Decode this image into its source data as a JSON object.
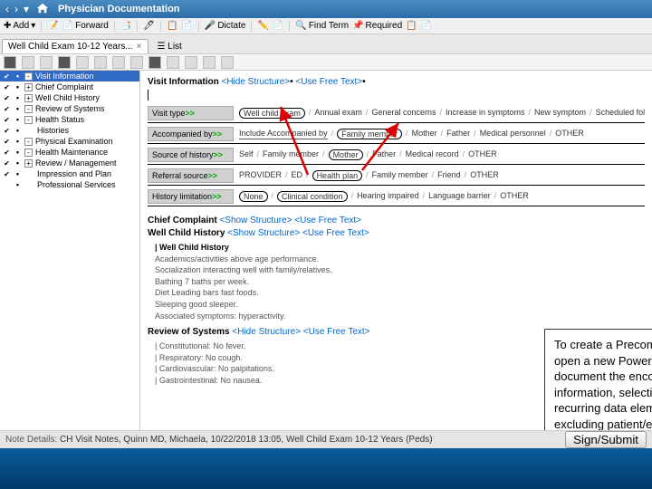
{
  "titlebar": {
    "back": "‹",
    "fwd": "›",
    "dropdown": "▾",
    "title": "Physician Documentation"
  },
  "toolbar1": {
    "add": "Add",
    "forward": "Forward",
    "dictate": "Dictate",
    "findterm": "Find Term",
    "required": "Required"
  },
  "tab": {
    "label": "Well Child Exam 10-12 Years...",
    "close": "×",
    "list": "List"
  },
  "sidebar": [
    {
      "c": true,
      "pm": "-",
      "label": "Visit Information",
      "sel": true
    },
    {
      "c": true,
      "pm": "+",
      "label": "Chief Complaint"
    },
    {
      "c": true,
      "pm": "+",
      "label": "Well Child History"
    },
    {
      "c": true,
      "pm": "-",
      "label": "Review of Systems"
    },
    {
      "c": true,
      "pm": "-",
      "label": "Health Status"
    },
    {
      "c": true,
      "pm": "",
      "label": "Histories"
    },
    {
      "c": true,
      "pm": "-",
      "label": "Physical Examination"
    },
    {
      "c": true,
      "pm": "-",
      "label": "Health Maintenance"
    },
    {
      "c": true,
      "pm": "+",
      "label": "Review / Management"
    },
    {
      "c": true,
      "pm": "",
      "label": "Impression and Plan"
    },
    {
      "c": false,
      "pm": "",
      "label": "Professional Services"
    }
  ],
  "sections": {
    "visit_info": {
      "title": "Visit Information",
      "hide": "<Hide Structure>",
      "free": "<Use Free Text>"
    },
    "rows": [
      {
        "label": "Visit type",
        "opts": [
          "Well child exam",
          "Annual exam",
          "General concerns",
          "Increase in symptoms",
          "New symptom",
          "Scheduled follow-up"
        ],
        "sel": 0
      },
      {
        "label": "Accompanied by",
        "pre": "Include Accompanied by",
        "opts": [
          "Family member",
          "Mother",
          "Father",
          "Medical personnel",
          "OTHER"
        ],
        "sel": 0
      },
      {
        "label": "Source of history",
        "opts": [
          "Self",
          "Family member",
          "Mother",
          "Father",
          "Medical record",
          "OTHER"
        ],
        "sel": 2
      },
      {
        "label": "Referral source",
        "opts": [
          "PROVIDER",
          "ED",
          "Health plan",
          "Family member",
          "Friend",
          "OTHER"
        ],
        "sel": 2
      },
      {
        "label": "History limitation",
        "opts": [
          "None",
          "Clinical condition",
          "Hearing impaired",
          "Language barrier",
          "OTHER"
        ],
        "sel": 0,
        "sel2": 1
      }
    ],
    "chief": {
      "title": "Chief Complaint",
      "show": "<Show Structure>",
      "free": "<Use Free Text>"
    },
    "wch": {
      "title": "Well Child History",
      "show": "<Show Structure>",
      "free": "<Use Free Text>",
      "sub_title": "| Well Child History",
      "lines": [
        "Academics/activities above age performance.",
        "Socialization interacting well with family/relatives.",
        "Bathing 7 baths per week.",
        "Diet Leading bars fast foods.",
        "Sleeping good sleeper.",
        "Associated symptoms: hyperactivity."
      ]
    },
    "ros": {
      "title": "Review of Systems",
      "hide": "<Hide Structure>",
      "free": "<Use Free Text>",
      "lines": [
        "| Constitutional: No fever.",
        "| Respiratory: No cough.",
        "| Cardiovascular: No palpitations.",
        "| Gastrointestinal: No nausea."
      ]
    }
  },
  "status": {
    "label": "Note Details:",
    "text": "CH Visit Notes, Quinn MD, Michaela, 10/22/2018 13:05, Well Child Exam 10-12 Years (Peds)",
    "sign": "Sign/Submit"
  },
  "callout": "To create a Precompleted Note, open a new Power. Note. Then document the encounter information, selecting the recurring data elements and excluding patient/encounter specific data."
}
